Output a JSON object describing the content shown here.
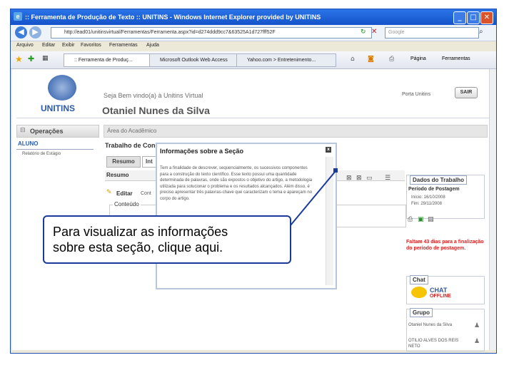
{
  "window": {
    "title": ":: Ferramenta de Produção de Texto :: UNITINS - Windows Internet Explorer provided by UNITINS",
    "minimize": "_",
    "maximize": "□",
    "close": "✕"
  },
  "address_bar": {
    "url": "http://ead01/unitinsvirtual/Ferramentas/Ferramenta.aspx?id=d274ddd9cc7&63525A1d727fff52F",
    "search_placeholder": "Google"
  },
  "menu": [
    "Arquivo",
    "Editar",
    "Exibir",
    "Favoritos",
    "Ferramentas",
    "Ajuda"
  ],
  "tabs": [
    {
      "label": ":: Ferramenta de Produç..."
    },
    {
      "label": "Microsoft Outlook Web Access"
    },
    {
      "label": "Yahoo.com > Entretenimento..."
    }
  ],
  "command_bar": {
    "page": "Página",
    "tools": "Ferramentas"
  },
  "site": {
    "logo_text": "UNITINS",
    "welcome": "Seja Bem vindo(a) à Unitins Virtual",
    "user_name": "Otaniel Nunes da Silva",
    "portal_link": "Porta Unitins",
    "logout": "SAIR",
    "left_menu": {
      "header": "Operações",
      "section": "ALUNO",
      "item": "Relatório de Estágio"
    },
    "breadcrumb": "Área do Acadêmico",
    "subtitle": "Trabalho de Conclusão de Curso - Grupo Tutorial",
    "tab_resumo": "Resumo",
    "tab_next": "Int",
    "section_resumo": "Resumo",
    "edit_label": "Editar",
    "edit_suffix": "Cont",
    "content_label": "Conteúdo"
  },
  "popup": {
    "title": "Informações sobre a Seção",
    "close": "x",
    "text": "Tem a finalidade de descrever, sequencialmente, os sucessivos componentes para a construção do texto científico. Esse texto possui uma quantidade determinada de palavras, onde são expostos o objetivo do artigo, a metodologia utilizada para solucionar o problema e os resultados alcançados. Além disso, é preciso apresentar três palavras-chave que caracterizam o tema e apareçam no corpo do artigo."
  },
  "right_panel": {
    "work_header": "Dados do Trabalho",
    "period_label": "Período de Postagem",
    "start": "Início: 16/10/2008",
    "end": "Fim: 29/11/2008",
    "remaining": "Faltam 43 dias para a finalização do período de postagem.",
    "chat_header": "Chat",
    "chat_status": "CHAT",
    "chat_status2": "OFFLINE",
    "group_header": "Grupo",
    "members": [
      "Otaniel Nunes da Silva",
      "OTILIO ALVES DOS REIS NETO"
    ]
  },
  "callout": {
    "line1": "Para visualizar as informações",
    "line2": "sobre esta seção, clique aqui."
  }
}
